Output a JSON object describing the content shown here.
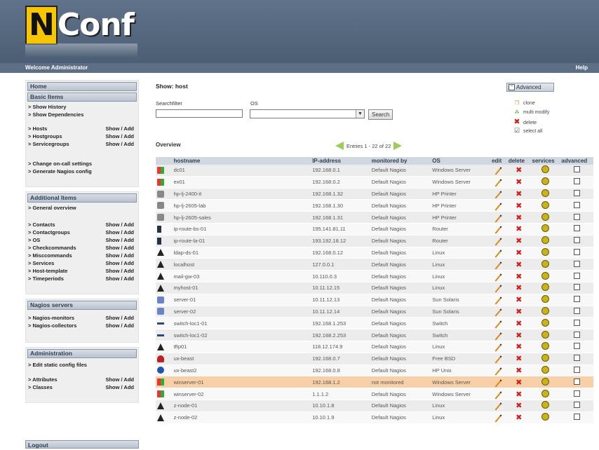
{
  "logo": {
    "first": "N",
    "rest": "Conf"
  },
  "topbar": {
    "welcome": "Welcome Administrator",
    "help": "Help"
  },
  "sidebar": {
    "home": "Home",
    "basic": {
      "title": "Basic Items",
      "links": [
        "> Show History",
        "> Show Dependencies"
      ],
      "groups": [
        {
          "label": "> Hosts",
          "action": "Show / Add"
        },
        {
          "label": "> Hostgroups",
          "action": "Show / Add"
        },
        {
          "label": "> Servicegroups",
          "action": "Show / Add"
        }
      ],
      "links2": [
        "> Change on-call settings",
        "> Generate Nagios config"
      ]
    },
    "additional": {
      "title": "Additional Items",
      "overview": "> General overview",
      "items": [
        {
          "label": "> Contacts",
          "action": "Show / Add"
        },
        {
          "label": "> Contactgroups",
          "action": "Show / Add"
        },
        {
          "label": "> OS",
          "action": "Show / Add"
        },
        {
          "label": "> Checkcommands",
          "action": "Show / Add"
        },
        {
          "label": "> Misccommands",
          "action": "Show / Add"
        },
        {
          "label": "> Services",
          "action": "Show / Add"
        },
        {
          "label": "> Host-template",
          "action": "Show / Add"
        },
        {
          "label": "> Timeperiods",
          "action": "Show / Add"
        }
      ]
    },
    "nagios": {
      "title": "Nagios servers",
      "items": [
        {
          "label": "> Nagios-monitors",
          "action": "Show / Add"
        },
        {
          "label": "> Nagios-collectors",
          "action": "Show / Add"
        }
      ]
    },
    "admin": {
      "title": "Administration",
      "link": "> Edit static config files",
      "items": [
        {
          "label": "> Attributes",
          "action": "Show / Add"
        },
        {
          "label": "> Classes",
          "action": "Show / Add"
        }
      ]
    },
    "logout": "Logout"
  },
  "main": {
    "title": "Show: host",
    "searchfilter_label": "Searchfilter",
    "searchfilter_value": "",
    "os_label": "OS",
    "os_value": "",
    "search_button": "Search",
    "overview": "Overview",
    "entries": "Entries 1 - 22 of 22"
  },
  "advanced": {
    "title": "Advanced",
    "clone": "clone",
    "multi": "multi modify",
    "delete": "delete",
    "selectall": "select all"
  },
  "table": {
    "headers": {
      "hostname": "hostname",
      "ip": "IP-address",
      "monitored": "monitored by",
      "os": "OS",
      "edit": "edit",
      "delete": "delete",
      "services": "services",
      "advanced": "advanced"
    },
    "rows": [
      {
        "icon": "windows-icon",
        "hostname": "dc01",
        "ip": "192.168.0.1",
        "monitored": "Default Nagios",
        "os": "Windows Server"
      },
      {
        "icon": "windows-icon",
        "hostname": "ex01",
        "ip": "192.168.0.2",
        "monitored": "Default Nagios",
        "os": "Windows Server"
      },
      {
        "icon": "printer-icon",
        "hostname": "hp-lj-2400-it",
        "ip": "192.168.1.32",
        "monitored": "Default Nagios",
        "os": "HP Printer"
      },
      {
        "icon": "printer-icon",
        "hostname": "hp-lj-2605-lab",
        "ip": "192.168.1.30",
        "monitored": "Default Nagios",
        "os": "HP Printer"
      },
      {
        "icon": "printer-icon",
        "hostname": "hp-lj-2605-sales",
        "ip": "192.168.1.31",
        "monitored": "Default Nagios",
        "os": "HP Printer"
      },
      {
        "icon": "router-icon",
        "hostname": "ip-route-bs-01",
        "ip": "195.141.81.11",
        "monitored": "Default Nagios",
        "os": "Router"
      },
      {
        "icon": "router-icon",
        "hostname": "ip-route-la-01",
        "ip": "193.192.18.12",
        "monitored": "Default Nagios",
        "os": "Router"
      },
      {
        "icon": "linux-icon",
        "hostname": "ldap-ds-01",
        "ip": "192.168.0.12",
        "monitored": "Default Nagios",
        "os": "Linux"
      },
      {
        "icon": "linux-icon",
        "hostname": "localhost",
        "ip": "127.0.0.1",
        "monitored": "Default Nagios",
        "os": "Linux"
      },
      {
        "icon": "linux-icon",
        "hostname": "mail-gw-03",
        "ip": "10.110.0.3",
        "monitored": "Default Nagios",
        "os": "Linux"
      },
      {
        "icon": "linux-icon",
        "hostname": "myhost-01",
        "ip": "10.11.12.15",
        "monitored": "Default Nagios",
        "os": "Linux"
      },
      {
        "icon": "solaris-icon",
        "hostname": "server-01",
        "ip": "10.11.12.13",
        "monitored": "Default Nagios",
        "os": "Sun Solaris"
      },
      {
        "icon": "solaris-icon",
        "hostname": "server-02",
        "ip": "10.11.12.14",
        "monitored": "Default Nagios",
        "os": "Sun Solaris"
      },
      {
        "icon": "switch-icon",
        "hostname": "switch-loc1-01",
        "ip": "192.168.1.253",
        "monitored": "Default Nagios",
        "os": "Switch"
      },
      {
        "icon": "switch-icon",
        "hostname": "switch-loc1-02",
        "ip": "192.168.2.253",
        "monitored": "Default Nagios",
        "os": "Switch"
      },
      {
        "icon": "linux-icon",
        "hostname": "tftp01",
        "ip": "118.12.174.9",
        "monitored": "Default Nagios",
        "os": "Linux"
      },
      {
        "icon": "bsd-icon",
        "hostname": "ux-beast",
        "ip": "192.168.0.7",
        "monitored": "Default Nagios",
        "os": "Free BSD"
      },
      {
        "icon": "hpux-icon",
        "hostname": "ux-beast2",
        "ip": "192.168.0.8",
        "monitored": "Default Nagios",
        "os": "HP Unix"
      },
      {
        "icon": "windows-icon",
        "hostname": "winserver-01",
        "ip": "192.168.1.2",
        "monitored": "not monitored",
        "os": "Windows Server",
        "highlight": true
      },
      {
        "icon": "windows-icon",
        "hostname": "winserver-02",
        "ip": "1.1.1.2",
        "monitored": "Default Nagios",
        "os": "Windows Server"
      },
      {
        "icon": "linux-icon",
        "hostname": "z-node-01",
        "ip": "10.10.1.8",
        "monitored": "Default Nagios",
        "os": "Linux"
      },
      {
        "icon": "linux-icon",
        "hostname": "z-node-02",
        "ip": "10.10.1.9",
        "monitored": "Default Nagios",
        "os": "Linux"
      }
    ]
  }
}
